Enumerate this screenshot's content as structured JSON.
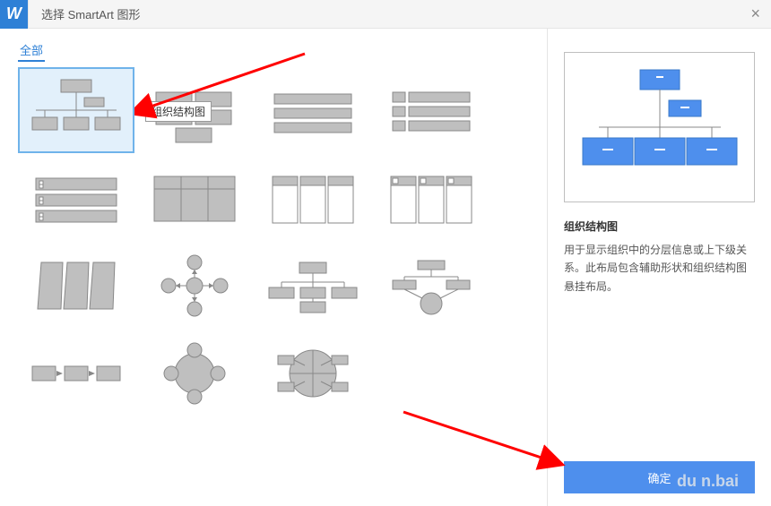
{
  "title": "选择 SmartArt 图形",
  "logo_text": "W",
  "tab_all": "全部",
  "tooltip": "组织结构图",
  "preview_name": "组织结构图",
  "preview_desc": "用于显示组织中的分层信息或上下级关系。此布局包含辅助形状和组织结构图悬挂布局。",
  "ok_label": "确定",
  "watermark": "du\nn.bai"
}
